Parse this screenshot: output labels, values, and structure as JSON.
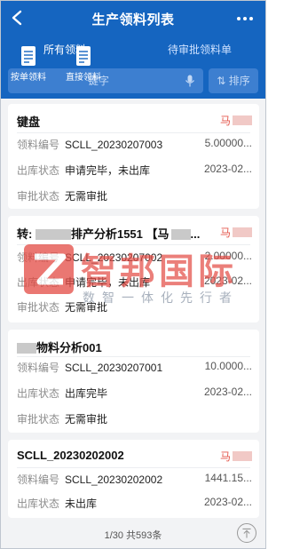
{
  "header": {
    "title": "生产领料列表"
  },
  "tabs": [
    {
      "label": "所有领料"
    },
    {
      "label": "待审批领料单"
    }
  ],
  "quick_actions": [
    {
      "label": "按单领料",
      "icon": "document-list-icon"
    },
    {
      "label": "直接领料",
      "icon": "document-list-icon"
    }
  ],
  "search": {
    "placeholder": "键字",
    "sort_label": "排序"
  },
  "cards": [
    {
      "title": "键盘",
      "person": "马",
      "rows": [
        {
          "label": "领料编号",
          "value": "SCLL_20230207003",
          "right": "5.00000..."
        },
        {
          "label": "出库状态",
          "value": "申请完毕，未出库",
          "right": "2023-02..."
        },
        {
          "label": "审批状态",
          "value": "无需审批",
          "right": ""
        }
      ]
    },
    {
      "title": "转:",
      "title_rest": "排产分析1551 【马",
      "title_tail": "...",
      "person": "马",
      "rows": [
        {
          "label": "领料编号",
          "value": "SCLL_20230207002",
          "right": "2.00000..."
        },
        {
          "label": "出库状态",
          "value": "申请完毕，未出库",
          "right": "2023-02..."
        },
        {
          "label": "审批状态",
          "value": "无需审批",
          "right": ""
        }
      ]
    },
    {
      "title": "物料分析001",
      "person": "",
      "rows": [
        {
          "label": "领料编号",
          "value": "SCLL_20230207001",
          "right": "10.0000..."
        },
        {
          "label": "出库状态",
          "value": "出库完毕",
          "right": "2023-02..."
        },
        {
          "label": "审批状态",
          "value": "无需审批",
          "right": ""
        }
      ]
    },
    {
      "title": "SCLL_20230202002",
      "person": "马",
      "rows": [
        {
          "label": "领料编号",
          "value": "SCLL_20230202002",
          "right": "1441.15..."
        },
        {
          "label": "出库状态",
          "value": "未出库",
          "right": "2023-02..."
        }
      ]
    }
  ],
  "footer": {
    "page_info": "1/30 共593条"
  },
  "watermark": {
    "name": "智邦国际",
    "slogan": "数智一体化先行者"
  },
  "colors": {
    "primary": "#1565c0",
    "person_red": "#e4574c",
    "watermark_red": "#e34a43"
  }
}
